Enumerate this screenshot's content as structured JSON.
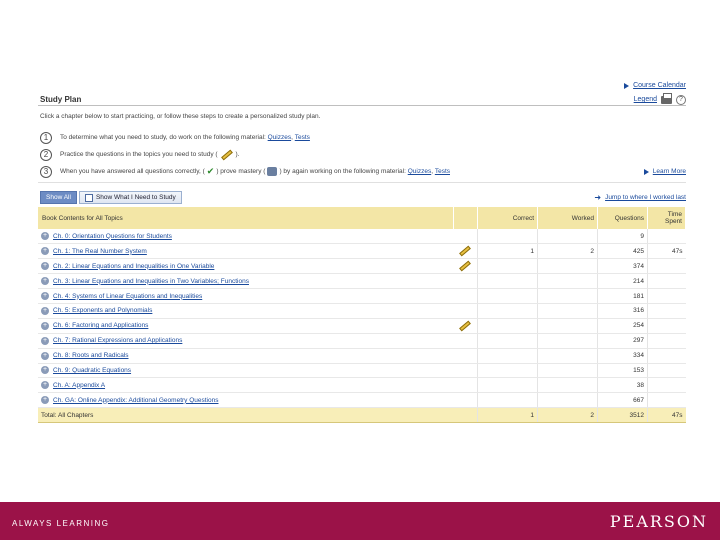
{
  "top_links": {
    "course_calendar": "Course Calendar",
    "legend": "Legend"
  },
  "page_title": "Study Plan",
  "intro_text": "Click a chapter below to start practicing, or follow these steps to create a personalized study plan.",
  "steps": [
    {
      "num": "1",
      "text": "To determine what you need to study, do work on the following material:",
      "link1": "Quizzes",
      "sep": ",",
      "link2": "Tests"
    },
    {
      "num": "2",
      "text": "Practice the questions in the topics you need to study (",
      "text_after": ")."
    },
    {
      "num": "3",
      "text": "When you have answered all questions correctly, (",
      "text_mid": ") prove mastery (",
      "text_end": ") by again working on the following material:",
      "link1": "Quizzes",
      "sep": ",",
      "link2": "Tests"
    }
  ],
  "learn_more": "Learn More",
  "tabs": {
    "show_all": "Show All",
    "show_need": "Show What I Need to Study"
  },
  "jump_link": "Jump to where I worked last",
  "table": {
    "headers": {
      "contents": "Book Contents for All Topics",
      "correct": "Correct",
      "worked": "Worked",
      "questions": "Questions",
      "time": "Time Spent"
    },
    "rows": [
      {
        "chapter": "Ch. 0: Orientation Questions for Students",
        "pencil": false,
        "correct": "",
        "worked": "",
        "questions": "9",
        "time": ""
      },
      {
        "chapter": "Ch. 1: The Real Number System",
        "pencil": true,
        "correct": "1",
        "worked": "2",
        "questions": "425",
        "time": "47s"
      },
      {
        "chapter": "Ch. 2: Linear Equations and Inequalities in One Variable",
        "pencil": true,
        "correct": "",
        "worked": "",
        "questions": "374",
        "time": ""
      },
      {
        "chapter": "Ch. 3: Linear Equations and Inequalities in Two Variables; Functions",
        "pencil": false,
        "correct": "",
        "worked": "",
        "questions": "214",
        "time": ""
      },
      {
        "chapter": "Ch. 4: Systems of Linear Equations and Inequalities",
        "pencil": false,
        "correct": "",
        "worked": "",
        "questions": "181",
        "time": ""
      },
      {
        "chapter": "Ch. 5: Exponents and Polynomials",
        "pencil": false,
        "correct": "",
        "worked": "",
        "questions": "316",
        "time": ""
      },
      {
        "chapter": "Ch. 6: Factoring and Applications",
        "pencil": true,
        "correct": "",
        "worked": "",
        "questions": "254",
        "time": ""
      },
      {
        "chapter": "Ch. 7: Rational Expressions and Applications",
        "pencil": false,
        "correct": "",
        "worked": "",
        "questions": "297",
        "time": ""
      },
      {
        "chapter": "Ch. 8: Roots and Radicals",
        "pencil": false,
        "correct": "",
        "worked": "",
        "questions": "334",
        "time": ""
      },
      {
        "chapter": "Ch. 9: Quadratic Equations",
        "pencil": false,
        "correct": "",
        "worked": "",
        "questions": "153",
        "time": ""
      },
      {
        "chapter": "Ch. A: Appendix A",
        "pencil": false,
        "correct": "",
        "worked": "",
        "questions": "38",
        "time": ""
      },
      {
        "chapter": "Ch. GA: Online Appendix: Additional Geometry Questions",
        "pencil": false,
        "correct": "",
        "worked": "",
        "questions": "667",
        "time": ""
      }
    ],
    "total": {
      "label": "Total: All Chapters",
      "correct": "1",
      "worked": "2",
      "questions": "3512",
      "time": "47s"
    }
  },
  "footer": {
    "tagline": "ALWAYS LEARNING",
    "brand": "PEARSON"
  },
  "colors": {
    "accent": "#1a4a9c",
    "header_bg": "#f3e6a6",
    "footer_bg": "#9b1248"
  }
}
